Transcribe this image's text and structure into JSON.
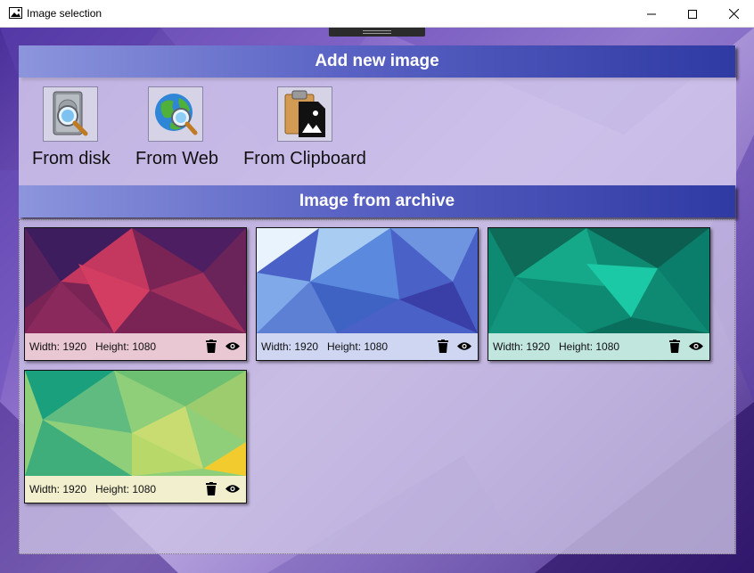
{
  "window": {
    "title": "Image selection",
    "icon": "picture-icon",
    "controls": [
      "minimize-icon",
      "maximize-icon",
      "close-icon"
    ]
  },
  "add_section": {
    "header": "Add new image",
    "sources": [
      {
        "label": "From disk",
        "icon": "disk-search-icon"
      },
      {
        "label": "From Web",
        "icon": "globe-search-icon"
      },
      {
        "label": "From Clipboard",
        "icon": "clipboard-image-icon"
      }
    ]
  },
  "archive": {
    "header": "Image from archive",
    "images": [
      {
        "width_label": "Width: 1920",
        "height_label": "Height: 1080",
        "theme": "red-purple",
        "colors": [
          "#3d1d5e",
          "#d33d62",
          "#8a2a5c"
        ],
        "footer_bg": "#e9c7d3"
      },
      {
        "width_label": "Width: 1920",
        "height_label": "Height: 1080",
        "theme": "blue",
        "colors": [
          "#d8ecfb",
          "#4a7fdd",
          "#3a3fa8"
        ],
        "footer_bg": "#cfd6f2"
      },
      {
        "width_label": "Width: 1920",
        "height_label": "Height: 1080",
        "theme": "teal",
        "colors": [
          "#0e6b57",
          "#1cc9a6",
          "#0b7d6b"
        ],
        "footer_bg": "#c1e6de"
      },
      {
        "width_label": "Width: 1920",
        "height_label": "Height: 1080",
        "theme": "green-yellow",
        "colors": [
          "#1aa07d",
          "#a8d27a",
          "#f2cc2e"
        ],
        "footer_bg": "#f2efcf"
      }
    ],
    "actions": [
      "trash-icon",
      "eye-icon"
    ]
  }
}
